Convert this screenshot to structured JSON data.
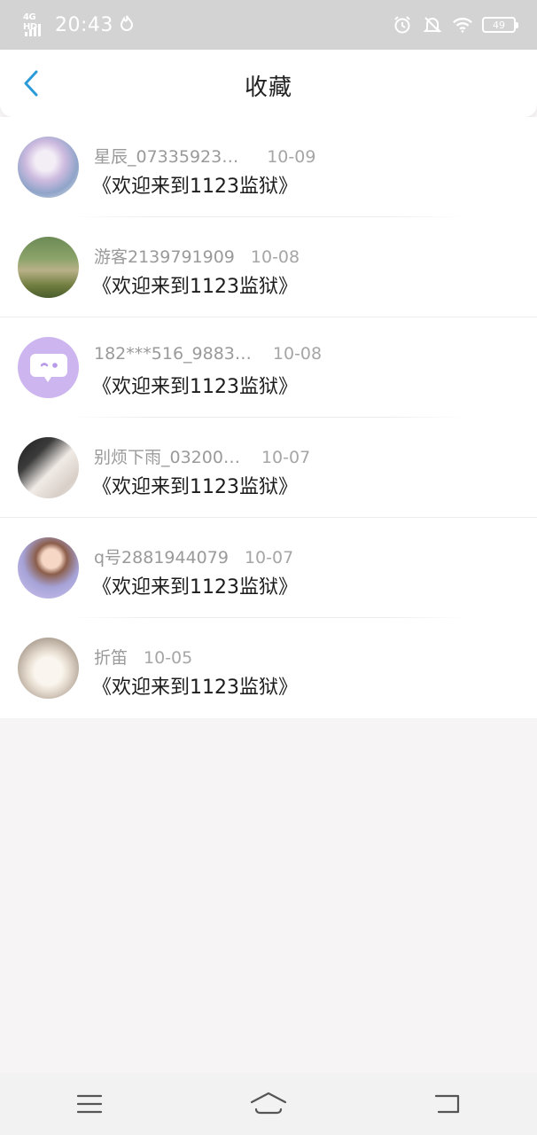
{
  "status_bar": {
    "network": "4G HD",
    "time": "20:43",
    "battery": "49"
  },
  "header": {
    "title": "收藏",
    "back_icon": "chevron-left-icon",
    "accent_color": "#2a9bd8"
  },
  "items": [
    {
      "user": "星辰_07335923…",
      "date": "10-09",
      "title": "《欢迎来到1123监狱》"
    },
    {
      "user": "游客2139791909",
      "date": "10-08",
      "title": "《欢迎来到1123监狱》"
    },
    {
      "user": "182***516_9883…",
      "date": "10-08",
      "title": "《欢迎来到1123监狱》"
    },
    {
      "user": "别烦下雨_03200…",
      "date": "10-07",
      "title": "《欢迎来到1123监狱》"
    },
    {
      "user": "q号2881944079",
      "date": "10-07",
      "title": "《欢迎来到1123监狱》"
    },
    {
      "user": "折笛",
      "date": "10-05",
      "title": "《欢迎来到1123监狱》"
    }
  ],
  "nav_bar": {
    "icons": [
      "menu-icon",
      "home-icon",
      "back-icon"
    ]
  }
}
